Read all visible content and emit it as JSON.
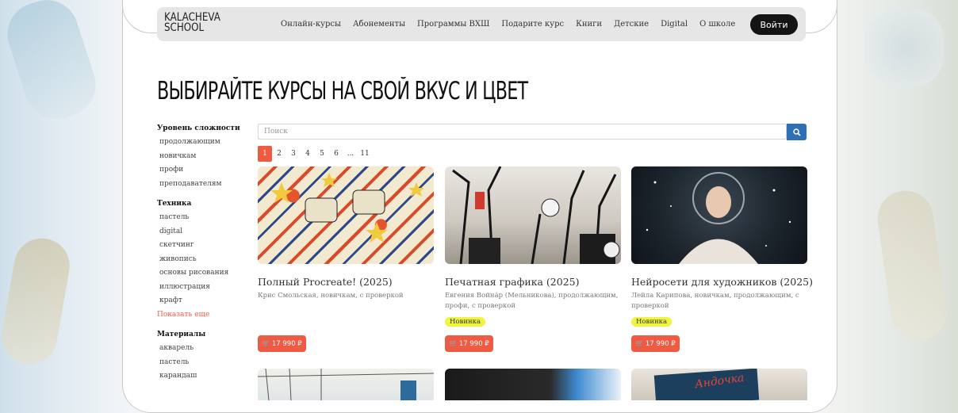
{
  "header": {
    "logo_line1": "KALACHEVA",
    "logo_line2": "SCHOOL",
    "nav": [
      "Онлайн-курсы",
      "Абонементы",
      "Программы ВХШ",
      "Подарите курс",
      "Книги",
      "Детские",
      "Digital",
      "О школе"
    ],
    "login_label": "Войти"
  },
  "page_title": "ВЫБИРАЙТЕ КУРСЫ НА СВОЙ ВКУС И ЦВЕТ",
  "filters": {
    "level_title": "Уровень сложности",
    "level_items": [
      "продолжающим",
      "новичкам",
      "профи",
      "преподавателям"
    ],
    "technique_title": "Техника",
    "technique_items": [
      "пастель",
      "digital",
      "скетчинг",
      "живопись",
      "основы рисования",
      "иллюстрация",
      "крафт"
    ],
    "show_more": "Показать еще",
    "materials_title": "Материалы",
    "materials_items": [
      "акварель",
      "пастель",
      "карандаш"
    ]
  },
  "search": {
    "placeholder": "Поиск"
  },
  "pagination": [
    "1",
    "2",
    "3",
    "4",
    "5",
    "6",
    "...",
    "11"
  ],
  "cards": [
    {
      "title": "Полный Procreate! (2025)",
      "meta": "Крис Смольская, новичкам, с проверкой",
      "badge": "",
      "price": "17 990 ₽"
    },
    {
      "title": "Печатная графика (2025)",
      "meta": "Евгения Война́р (Мельникова), продолжающим, профи, с проверкой",
      "badge": "Новинка",
      "price": "17 990 ₽"
    },
    {
      "title": "Нейросети для художников (2025)",
      "meta": "Лейла Карипова, новичкам, продолжающим, с проверкой",
      "badge": "Новинка",
      "price": "17 990 ₽"
    }
  ],
  "colors": {
    "accent": "#ef5a43",
    "badge": "#eef53c",
    "search_button": "#2f6fb6",
    "login": "#141414"
  }
}
